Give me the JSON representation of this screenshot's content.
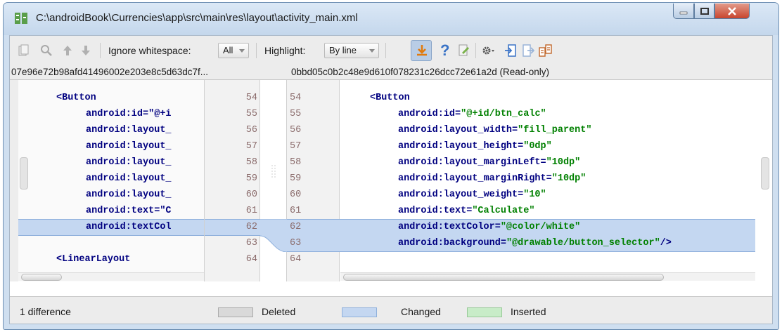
{
  "window": {
    "title": "C:\\androidBook\\Currencies\\app\\src\\main\\res\\layout\\activity_main.xml"
  },
  "toolbar": {
    "ignore_whitespace_label": "Ignore whitespace:",
    "ignore_whitespace_value": "All",
    "highlight_label": "Highlight:",
    "highlight_value": "By line",
    "help_glyph": "?"
  },
  "left_pane": {
    "revision": "07e96e72b98afd41496002e203e8c5d63dc7f...",
    "lines": [
      {
        "code": "<Button",
        "num": "54"
      },
      {
        "code": "android:id=\"@+i",
        "num": "55"
      },
      {
        "code": "android:layout_",
        "num": "56"
      },
      {
        "code": "android:layout_",
        "num": "57"
      },
      {
        "code": "android:layout_",
        "num": "58"
      },
      {
        "code": "android:layout_",
        "num": "59"
      },
      {
        "code": "android:layout_",
        "num": "60"
      },
      {
        "code": "android:text=\"C",
        "num": "61"
      },
      {
        "code": "android:textCol",
        "num": "62"
      },
      {
        "code": "",
        "num": "63"
      },
      {
        "code": "<LinearLayout",
        "num": "64"
      }
    ]
  },
  "right_pane": {
    "revision": "0bbd05c0b2c48e9d610f078231c26dcc72e61a2d (Read-only)",
    "lines": [
      {
        "num": "54",
        "attr": "<Button",
        "value": ""
      },
      {
        "num": "55",
        "attr": "android:id=",
        "value": "\"@+id/btn_calc\""
      },
      {
        "num": "56",
        "attr": "android:layout_width=",
        "value": "\"fill_parent\""
      },
      {
        "num": "57",
        "attr": "android:layout_height=",
        "value": "\"0dp\""
      },
      {
        "num": "58",
        "attr": "android:layout_marginLeft=",
        "value": "\"10dp\""
      },
      {
        "num": "59",
        "attr": "android:layout_marginRight=",
        "value": "\"10dp\""
      },
      {
        "num": "60",
        "attr": "android:layout_weight=",
        "value": "\"10\""
      },
      {
        "num": "61",
        "attr": "android:text=",
        "value": "\"Calculate\""
      },
      {
        "num": "62",
        "attr": "android:textColor=",
        "value": "\"@color/white\""
      },
      {
        "num": "63",
        "attr": "android:background=",
        "value": "\"@drawable/button_selector\"",
        "tail": "/>"
      },
      {
        "num": "64",
        "attr": "",
        "value": ""
      }
    ]
  },
  "status": {
    "difference_count": "1 difference",
    "legend": [
      {
        "label": "Deleted",
        "color": "#d9d9d9"
      },
      {
        "label": "Changed",
        "color": "#c4d7f1"
      },
      {
        "label": "Inserted",
        "color": "#c8ecc8"
      }
    ]
  },
  "colors": {
    "changed_highlight": "#c4d7f1",
    "code_attribute": "#000080",
    "code_value": "#008000",
    "line_number": "#8a6b6b"
  }
}
